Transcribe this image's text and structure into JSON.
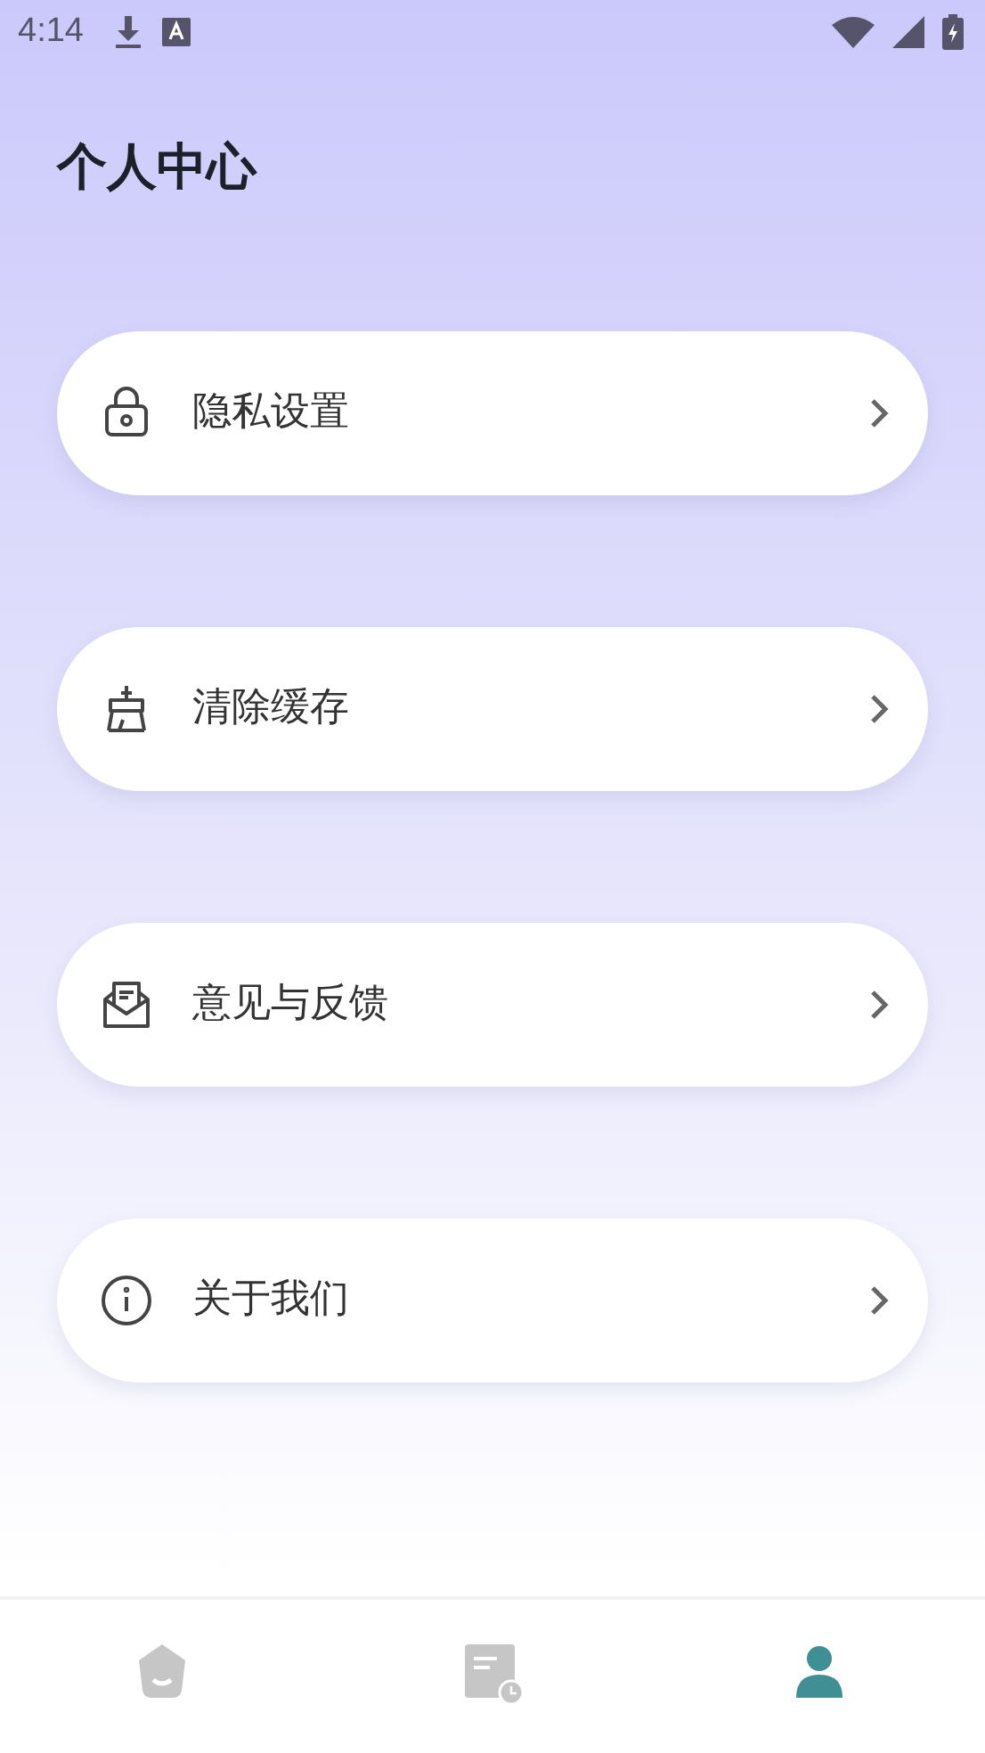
{
  "status_bar": {
    "time": "4:14"
  },
  "title": "个人中心",
  "menu": [
    {
      "kind": "lock",
      "label": "隐私设置"
    },
    {
      "kind": "broom",
      "label": "清除缓存"
    },
    {
      "kind": "mail",
      "label": "意见与反馈"
    },
    {
      "kind": "info",
      "label": "关于我们"
    }
  ],
  "bottom_nav": [
    {
      "kind": "home",
      "selected": false
    },
    {
      "kind": "history",
      "selected": false
    },
    {
      "kind": "profile",
      "selected": true
    }
  ]
}
